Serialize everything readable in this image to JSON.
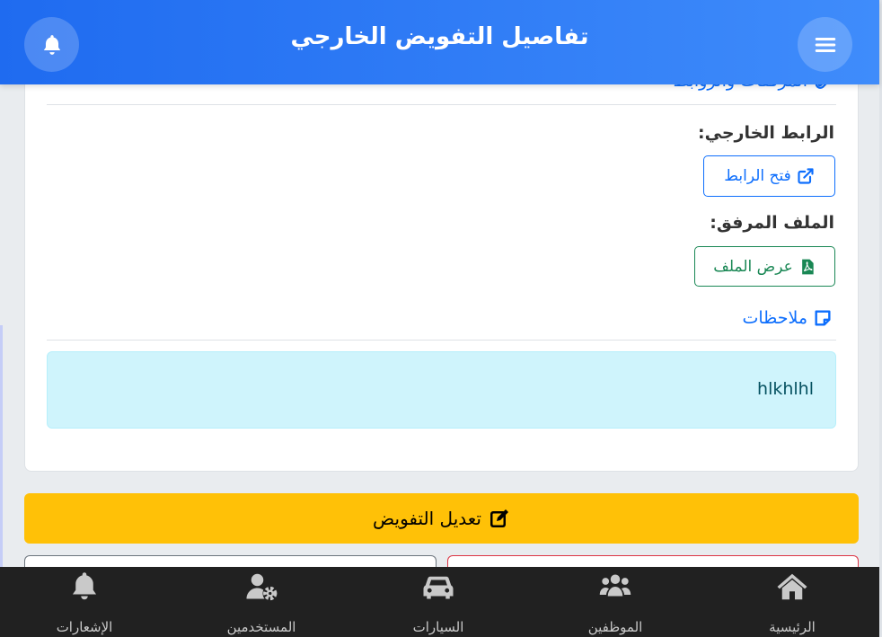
{
  "header": {
    "title": "تفاصيل التفويض الخارجي",
    "menu_icon": "hamburger-icon",
    "bell_icon": "bell-icon"
  },
  "attachments": {
    "title": "المرفقات والروابط",
    "external_link_label": "الرابط الخارجي:",
    "open_link_button": "فتح الرابط",
    "attached_file_label": "الملف المرفق:",
    "view_file_button": "عرض الملف"
  },
  "notes": {
    "title": "ملاحظات",
    "text": "hlkhlhl"
  },
  "actions": {
    "edit_button": "تعديل التفويض"
  },
  "bottom_nav": {
    "home": "الرئيسية",
    "employees": "الموظفين",
    "cars": "السيارات",
    "users": "المستخدمين",
    "notifications": "الإشعارات"
  },
  "colors": {
    "header_start": "#1f6bf0",
    "header_end": "#3f8cfb",
    "primary": "#0d6efd",
    "success": "#198754",
    "warning": "#ffc107",
    "info_bg": "#cff4fc",
    "nav_bg": "#212121"
  }
}
